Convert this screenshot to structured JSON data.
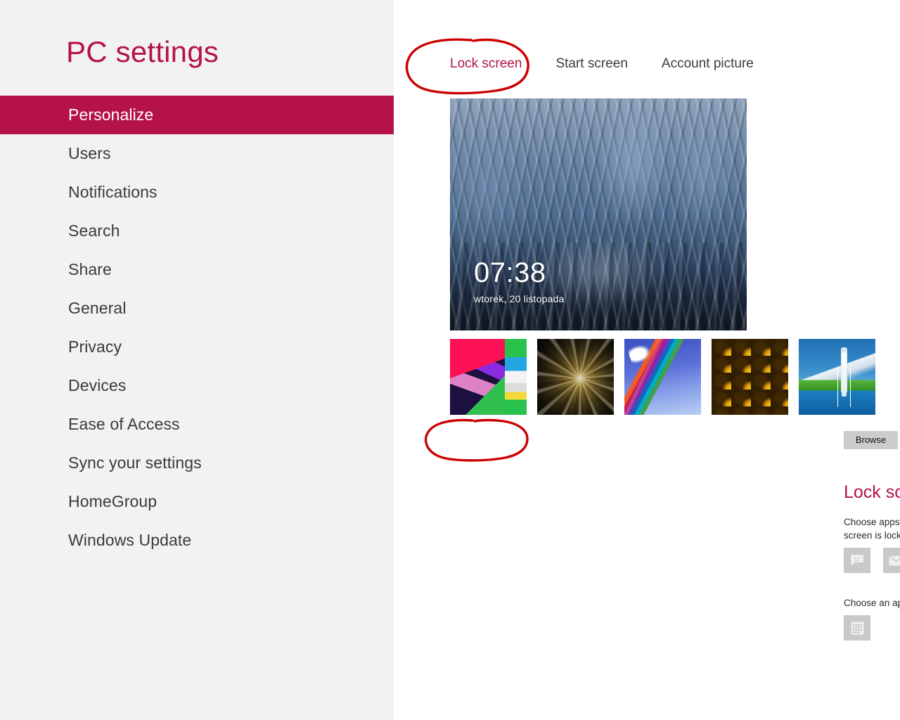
{
  "app": {
    "title": "PC settings",
    "accent_color": "#b5124a",
    "sidebar_bg": "#f2f2f2",
    "annotation_color": "#cc0000"
  },
  "sidebar": {
    "title": "PC settings",
    "items": [
      {
        "label": "Personalize",
        "selected": true
      },
      {
        "label": "Users",
        "selected": false
      },
      {
        "label": "Notifications",
        "selected": false
      },
      {
        "label": "Search",
        "selected": false
      },
      {
        "label": "Share",
        "selected": false
      },
      {
        "label": "General",
        "selected": false
      },
      {
        "label": "Privacy",
        "selected": false
      },
      {
        "label": "Devices",
        "selected": false
      },
      {
        "label": "Ease of Access",
        "selected": false
      },
      {
        "label": "Sync your settings",
        "selected": false
      },
      {
        "label": "HomeGroup",
        "selected": false
      },
      {
        "label": "Windows Update",
        "selected": false
      }
    ]
  },
  "content": {
    "tabs": [
      {
        "label": "Lock screen",
        "active": true
      },
      {
        "label": "Start screen",
        "active": false
      },
      {
        "label": "Account picture",
        "active": false
      }
    ],
    "preview": {
      "name": "city-tunnel-motion-blur",
      "clock_time": "07:38",
      "clock_date": "wtorek, 20 listopada"
    },
    "thumbnails": [
      {
        "name": "geometric-abstract"
      },
      {
        "name": "nautilus-shell"
      },
      {
        "name": "rainbow-bird"
      },
      {
        "name": "honeycomb"
      },
      {
        "name": "seattle-space-needle"
      }
    ],
    "browse_button": "Browse",
    "apps_section": {
      "heading": "Lock screen apps",
      "description": "Choose apps to run in the background and show quick status and notifications, even when your screen is locked",
      "tiles": [
        {
          "name": "messaging-icon",
          "type": "app",
          "glyph": ""
        },
        {
          "name": "mail-icon",
          "type": "app",
          "glyph": ""
        },
        {
          "name": "calendar-icon",
          "type": "app",
          "glyph": ""
        },
        {
          "name": "add-app-slot-1",
          "type": "plus",
          "glyph": "+"
        },
        {
          "name": "add-app-slot-2",
          "type": "plus",
          "glyph": "+"
        },
        {
          "name": "add-app-slot-3",
          "type": "plus",
          "glyph": "+"
        },
        {
          "name": "add-app-slot-4",
          "type": "plus",
          "glyph": "+"
        }
      ],
      "detailed_status_label": "Choose an app to display detailed status",
      "detailed_status_tile": {
        "name": "calendar-icon",
        "glyph": ""
      }
    }
  },
  "annotations": [
    {
      "name": "annotation-circle-lock-screen-tab",
      "target": "Lock screen"
    },
    {
      "name": "annotation-circle-browse-button",
      "target": "Browse"
    }
  ]
}
